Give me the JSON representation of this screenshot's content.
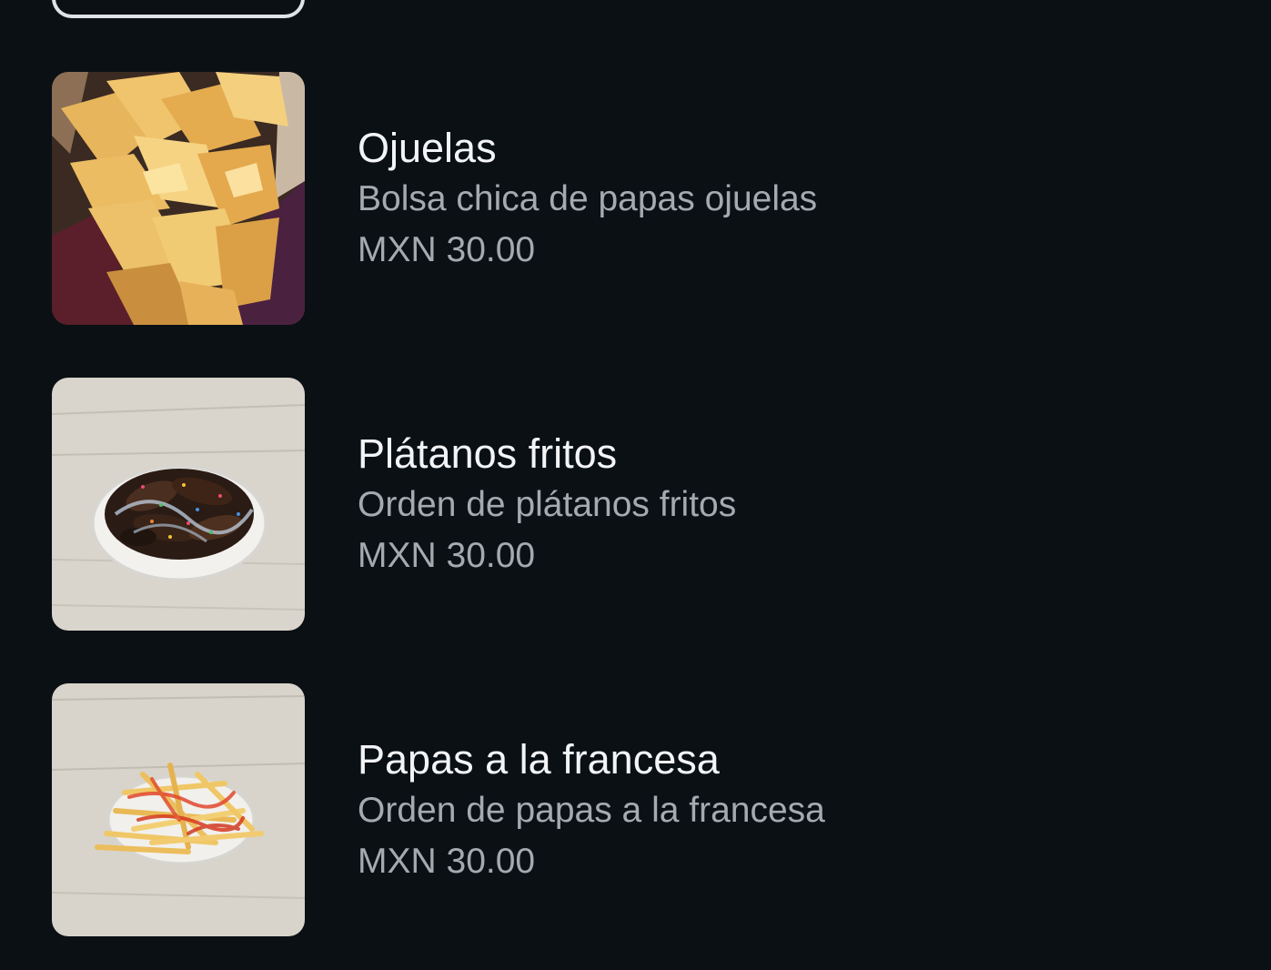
{
  "menu": {
    "items": [
      {
        "title": "Ojuelas",
        "description": "Bolsa chica de papas ojuelas",
        "price": "MXN 30.00",
        "image_icon": "chips-photo"
      },
      {
        "title": "Plátanos fritos",
        "description": "Orden de plátanos fritos",
        "price": "MXN 30.00",
        "image_icon": "fried-plantains-photo"
      },
      {
        "title": "Papas a la francesa",
        "description": "Orden de papas a la francesa",
        "price": "MXN 30.00",
        "image_icon": "french-fries-photo"
      }
    ]
  },
  "colors": {
    "background": "#0b1015",
    "title": "#f2f4f6",
    "secondary_text": "#a4aab0"
  }
}
